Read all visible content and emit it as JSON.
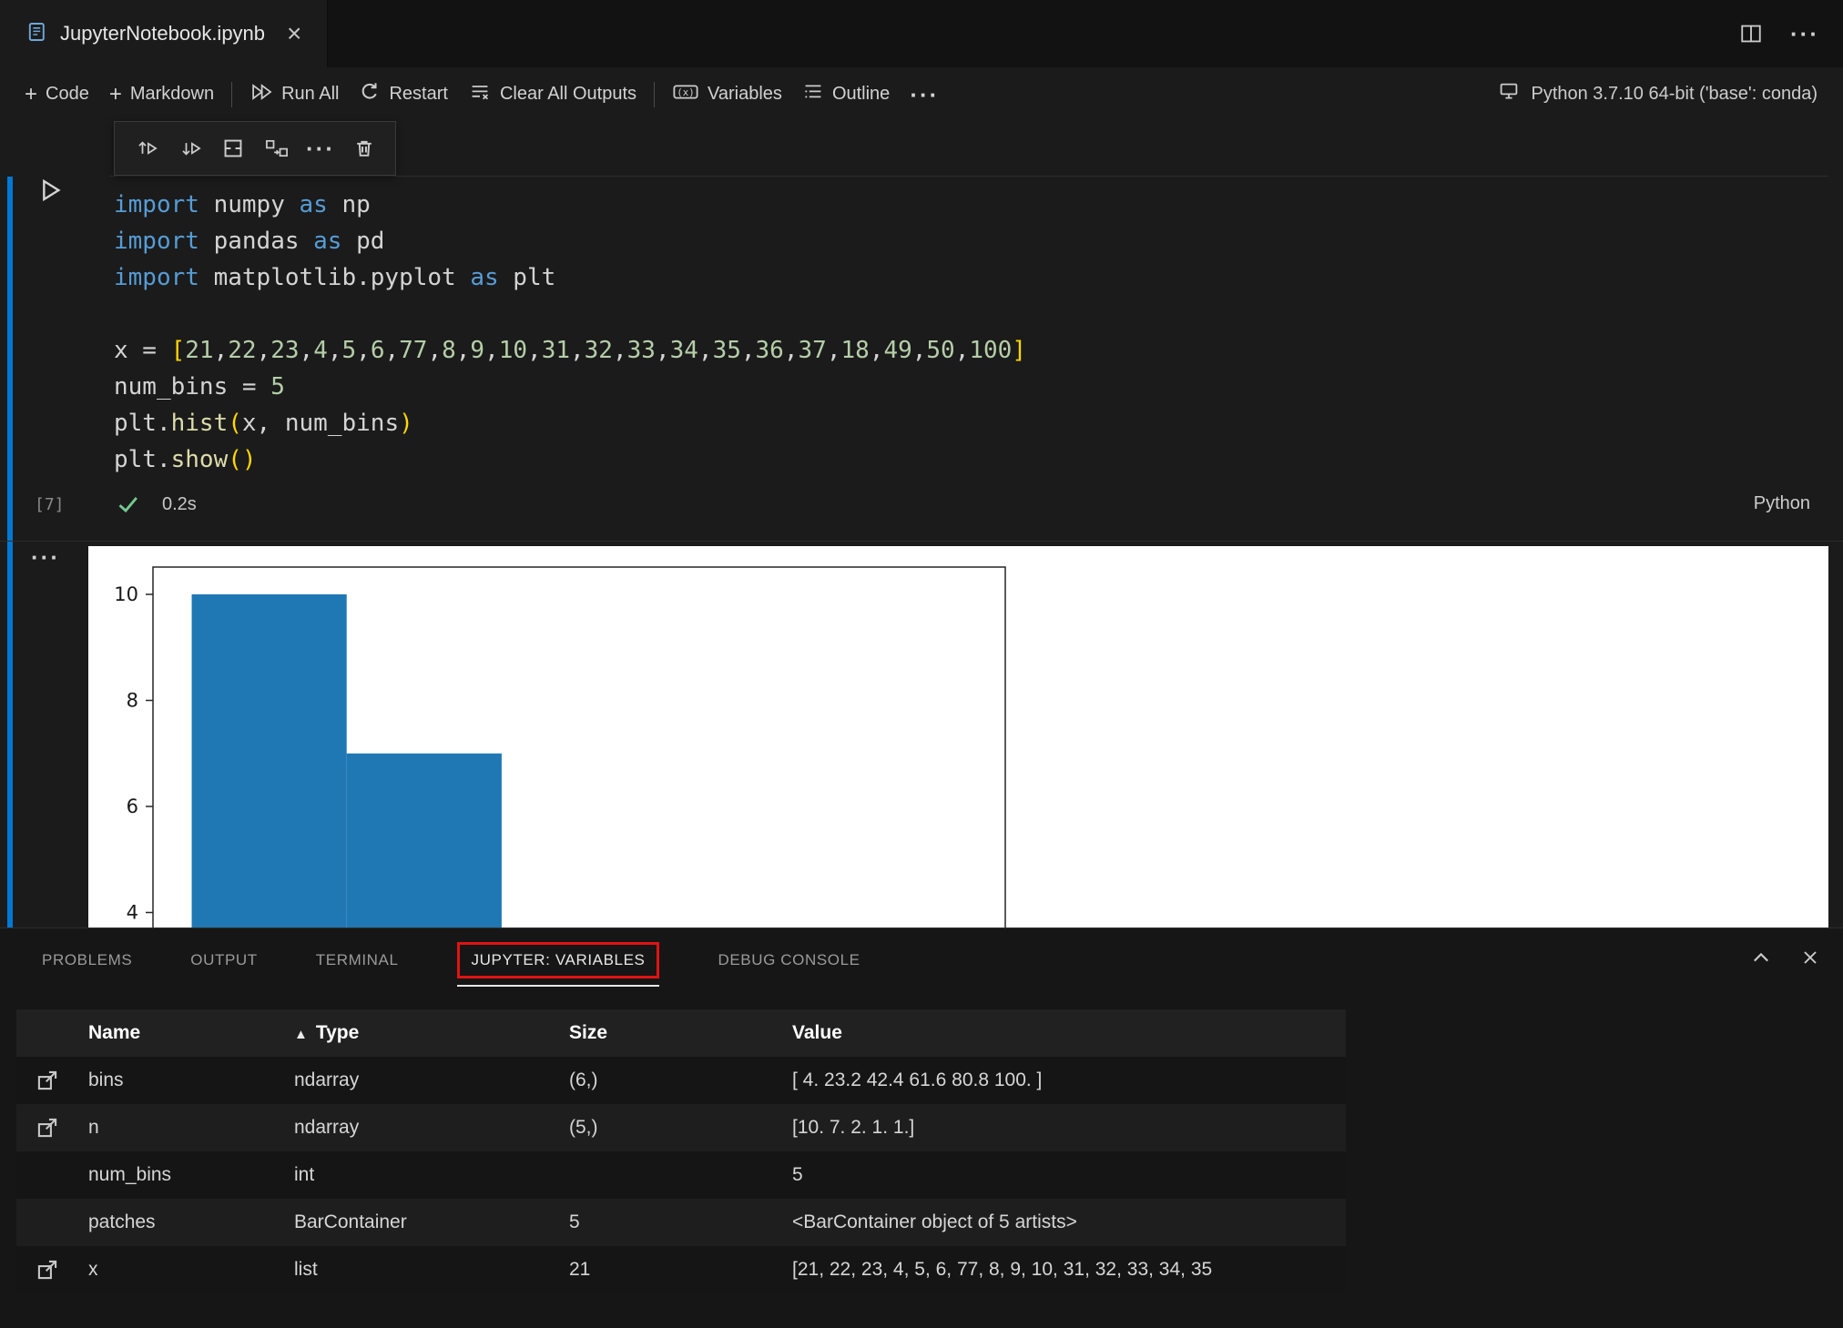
{
  "window": {
    "tab_title": "JupyterNotebook.ipynb"
  },
  "icons": {
    "close": "×",
    "more": "···",
    "plus": "+"
  },
  "toolbar": {
    "code": "Code",
    "markdown": "Markdown",
    "run_all": "Run All",
    "restart": "Restart",
    "clear_all_outputs": "Clear All Outputs",
    "variables": "Variables",
    "outline": "Outline",
    "kernel": "Python 3.7.10 64-bit ('base': conda)"
  },
  "cell": {
    "execution_count": "[7]",
    "duration": "0.2s",
    "language": "Python",
    "lines": [
      [
        {
          "c": "kw",
          "t": "import"
        },
        {
          "c": "pl",
          "t": " numpy "
        },
        {
          "c": "kw",
          "t": "as"
        },
        {
          "c": "pl",
          "t": " np"
        }
      ],
      [
        {
          "c": "kw",
          "t": "import"
        },
        {
          "c": "pl",
          "t": " pandas "
        },
        {
          "c": "kw",
          "t": "as"
        },
        {
          "c": "pl",
          "t": " pd"
        }
      ],
      [
        {
          "c": "kw",
          "t": "import"
        },
        {
          "c": "pl",
          "t": " matplotlib.pyplot "
        },
        {
          "c": "kw",
          "t": "as"
        },
        {
          "c": "pl",
          "t": " plt"
        }
      ],
      [],
      [
        {
          "c": "pl",
          "t": "x = "
        },
        {
          "c": "brk",
          "t": "["
        },
        {
          "c": "num",
          "t": "21"
        },
        {
          "c": "pl",
          "t": ","
        },
        {
          "c": "num",
          "t": "22"
        },
        {
          "c": "pl",
          "t": ","
        },
        {
          "c": "num",
          "t": "23"
        },
        {
          "c": "pl",
          "t": ","
        },
        {
          "c": "num",
          "t": "4"
        },
        {
          "c": "pl",
          "t": ","
        },
        {
          "c": "num",
          "t": "5"
        },
        {
          "c": "pl",
          "t": ","
        },
        {
          "c": "num",
          "t": "6"
        },
        {
          "c": "pl",
          "t": ","
        },
        {
          "c": "num",
          "t": "77"
        },
        {
          "c": "pl",
          "t": ","
        },
        {
          "c": "num",
          "t": "8"
        },
        {
          "c": "pl",
          "t": ","
        },
        {
          "c": "num",
          "t": "9"
        },
        {
          "c": "pl",
          "t": ","
        },
        {
          "c": "num",
          "t": "10"
        },
        {
          "c": "pl",
          "t": ","
        },
        {
          "c": "num",
          "t": "31"
        },
        {
          "c": "pl",
          "t": ","
        },
        {
          "c": "num",
          "t": "32"
        },
        {
          "c": "pl",
          "t": ","
        },
        {
          "c": "num",
          "t": "33"
        },
        {
          "c": "pl",
          "t": ","
        },
        {
          "c": "num",
          "t": "34"
        },
        {
          "c": "pl",
          "t": ","
        },
        {
          "c": "num",
          "t": "35"
        },
        {
          "c": "pl",
          "t": ","
        },
        {
          "c": "num",
          "t": "36"
        },
        {
          "c": "pl",
          "t": ","
        },
        {
          "c": "num",
          "t": "37"
        },
        {
          "c": "pl",
          "t": ","
        },
        {
          "c": "num",
          "t": "18"
        },
        {
          "c": "pl",
          "t": ","
        },
        {
          "c": "num",
          "t": "49"
        },
        {
          "c": "pl",
          "t": ","
        },
        {
          "c": "num",
          "t": "50"
        },
        {
          "c": "pl",
          "t": ","
        },
        {
          "c": "num",
          "t": "100"
        },
        {
          "c": "brk",
          "t": "]"
        }
      ],
      [
        {
          "c": "pl",
          "t": "num_bins = "
        },
        {
          "c": "num",
          "t": "5"
        }
      ],
      [
        {
          "c": "pl",
          "t": "plt."
        },
        {
          "c": "fn",
          "t": "hist"
        },
        {
          "c": "brk",
          "t": "("
        },
        {
          "c": "pl",
          "t": "x, num_bins"
        },
        {
          "c": "brk",
          "t": ")"
        }
      ],
      [
        {
          "c": "pl",
          "t": "plt."
        },
        {
          "c": "fn",
          "t": "show"
        },
        {
          "c": "brk",
          "t": "()"
        }
      ]
    ]
  },
  "chart_data": {
    "type": "histogram",
    "bin_edges": [
      4,
      23.2,
      42.4,
      61.6,
      80.8,
      100
    ],
    "counts": [
      10,
      7,
      2,
      1,
      1
    ],
    "visible_yticks": [
      4,
      6,
      8,
      10
    ],
    "xlim": [
      -0.8,
      104.8
    ],
    "ylim": [
      0,
      10.5
    ],
    "bar_color": "#1f77b4",
    "source_values": [
      21,
      22,
      23,
      4,
      5,
      6,
      77,
      8,
      9,
      10,
      31,
      32,
      33,
      34,
      35,
      36,
      37,
      18,
      49,
      50,
      100
    ],
    "num_bins": 5,
    "grid": false,
    "title": "",
    "xlabel": "",
    "ylabel": ""
  },
  "panel": {
    "tabs": [
      {
        "label": "PROBLEMS"
      },
      {
        "label": "OUTPUT"
      },
      {
        "label": "TERMINAL"
      },
      {
        "label": "JUPYTER: VARIABLES",
        "active": true,
        "highlighted": true
      },
      {
        "label": "DEBUG CONSOLE"
      }
    ],
    "table": {
      "headers": {
        "name": "Name",
        "type": "Type",
        "size": "Size",
        "value": "Value",
        "sort_indicator": "▲"
      },
      "rows": [
        {
          "name": "bins",
          "type": "ndarray",
          "size": "(6,)",
          "value": "[ 4. 23.2 42.4 61.6 80.8 100. ]",
          "link": true
        },
        {
          "name": "n",
          "type": "ndarray",
          "size": "(5,)",
          "value": "[10. 7. 2. 1. 1.]",
          "link": true
        },
        {
          "name": "num_bins",
          "type": "int",
          "size": "",
          "value": "5",
          "link": false
        },
        {
          "name": "patches",
          "type": "BarContainer",
          "size": "5",
          "value": "<BarContainer object of 5 artists>",
          "link": false
        },
        {
          "name": "x",
          "type": "list",
          "size": "21",
          "value": "[21, 22, 23, 4, 5, 6, 77, 8, 9, 10, 31, 32, 33, 34, 35",
          "link": true
        }
      ]
    }
  }
}
